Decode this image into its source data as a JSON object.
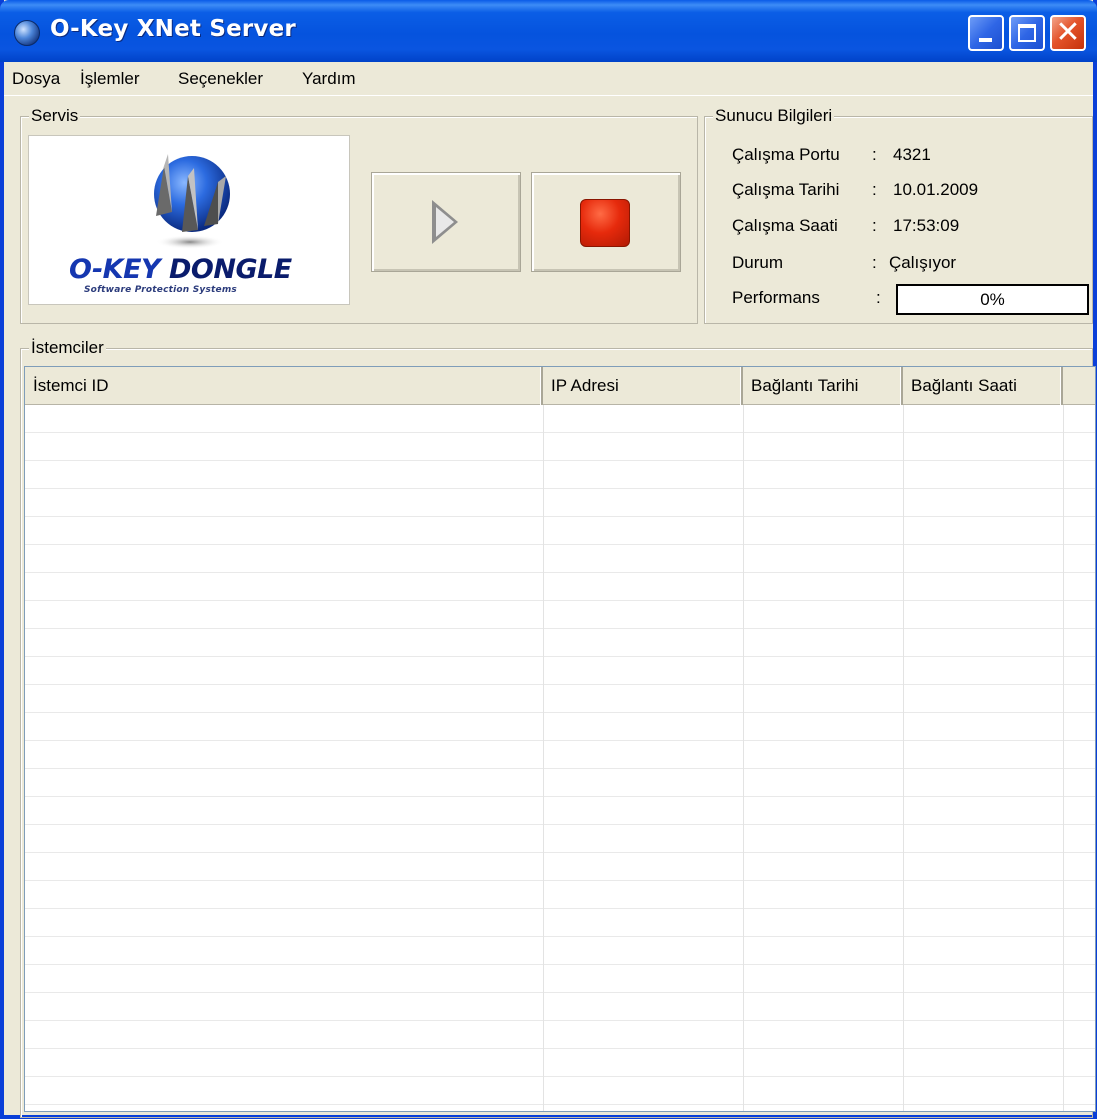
{
  "window": {
    "title": "O-Key XNet Server",
    "close_glyph": "✕"
  },
  "menu": [
    "Dosya",
    "İşlemler",
    "Seçenekler",
    "Yardım"
  ],
  "service": {
    "legend": "Servis",
    "logo_text_a": "O-KEY",
    "logo_text_b": "DONGLE",
    "logo_subtitle": "Software Protection Systems",
    "start_icon": "play-icon",
    "stop_icon": "stop-icon"
  },
  "server_info": {
    "legend": "Sunucu Bilgileri",
    "separator": ":",
    "port_label": "Çalışma Portu",
    "port_value": "4321",
    "date_label": "Çalışma Tarihi",
    "date_value": "10.01.2009",
    "time_label": "Çalışma Saati",
    "time_value": "17:53:09",
    "status_label": "Durum",
    "status_value": "Çalışıyor",
    "perf_label": "Performans",
    "perf_text": "0%",
    "perf_value": 0
  },
  "clients": {
    "legend": "İstemciler",
    "columns": [
      "İstemci ID",
      "IP Adresi",
      "Bağlantı Tarihi",
      "Bağlantı Saati"
    ],
    "rows": []
  },
  "colors": {
    "titlebar": "#0553de",
    "stop_red": "#e62a0c",
    "window_bg": "#ece9d8"
  }
}
